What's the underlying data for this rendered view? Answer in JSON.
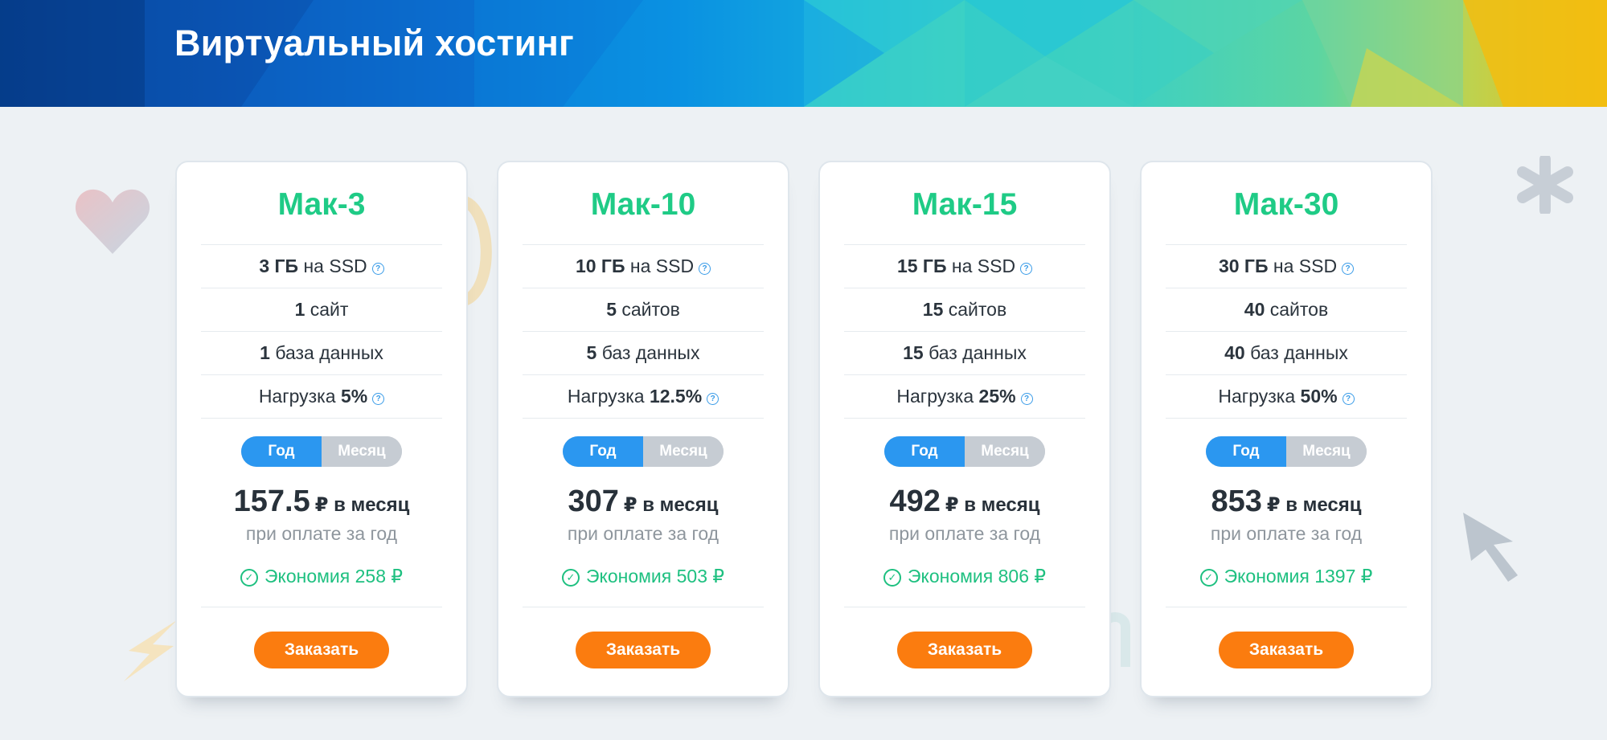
{
  "header": {
    "title": "Виртуальный хостинг"
  },
  "colors": {
    "accent_green": "#1fcb86",
    "toggle_blue": "#2b97f0",
    "order_orange": "#fb7c0f"
  },
  "icons": [
    "heart-icon",
    "asterisk-icon",
    "chevron-right-icon",
    "cursor-arrow-icon",
    "help-icon",
    "check-circle-icon"
  ],
  "plans": [
    {
      "name": "Мак-3",
      "disk_value": "3 ГБ",
      "disk_suffix": "на SSD",
      "sites_value": "1",
      "sites_suffix": "сайт",
      "db_value": "1",
      "db_suffix": "база данных",
      "load_prefix": "Нагрузка",
      "load_value": "5%",
      "toggle_year": "Год",
      "toggle_month": "Месяц",
      "price": "157.5",
      "price_unit": "₽ в месяц",
      "price_note": "при оплате за год",
      "saving": "Экономия 258 ₽",
      "order_label": "Заказать"
    },
    {
      "name": "Мак-10",
      "disk_value": "10 ГБ",
      "disk_suffix": "на SSD",
      "sites_value": "5",
      "sites_suffix": "сайтов",
      "db_value": "5",
      "db_suffix": "баз данных",
      "load_prefix": "Нагрузка",
      "load_value": "12.5%",
      "toggle_year": "Год",
      "toggle_month": "Месяц",
      "price": "307",
      "price_unit": "₽ в месяц",
      "price_note": "при оплате за год",
      "saving": "Экономия 503 ₽",
      "order_label": "Заказать"
    },
    {
      "name": "Мак-15",
      "disk_value": "15 ГБ",
      "disk_suffix": "на SSD",
      "sites_value": "15",
      "sites_suffix": "сайтов",
      "db_value": "15",
      "db_suffix": "баз данных",
      "load_prefix": "Нагрузка",
      "load_value": "25%",
      "toggle_year": "Год",
      "toggle_month": "Месяц",
      "price": "492",
      "price_unit": "₽ в месяц",
      "price_note": "при оплате за год",
      "saving": "Экономия 806 ₽",
      "order_label": "Заказать"
    },
    {
      "name": "Мак-30",
      "disk_value": "30 ГБ",
      "disk_suffix": "на SSD",
      "sites_value": "40",
      "sites_suffix": "сайтов",
      "db_value": "40",
      "db_suffix": "баз данных",
      "load_prefix": "Нагрузка",
      "load_value": "50%",
      "toggle_year": "Год",
      "toggle_month": "Месяц",
      "price": "853",
      "price_unit": "₽ в месяц",
      "price_note": "при оплате за год",
      "saving": "Экономия 1397 ₽",
      "order_label": "Заказать"
    }
  ]
}
